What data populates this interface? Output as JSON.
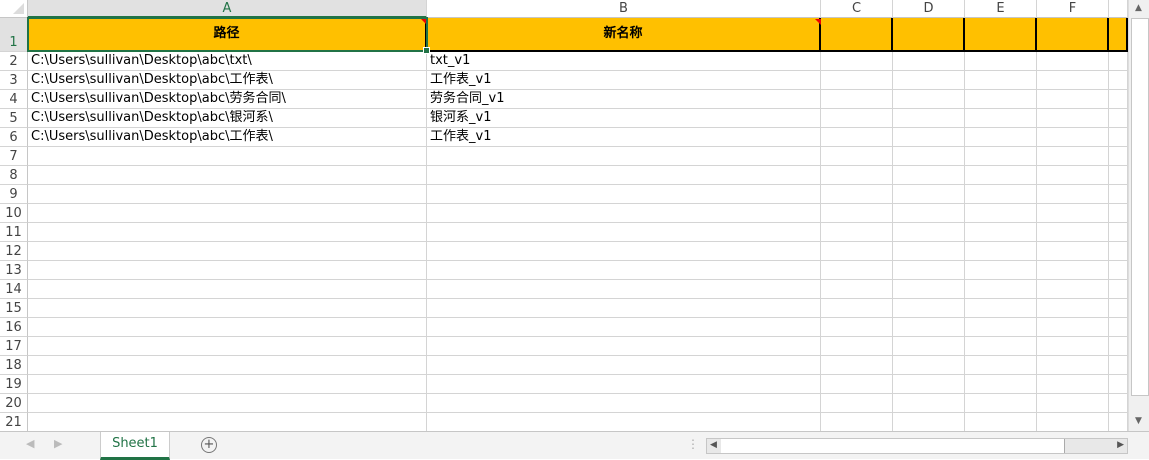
{
  "columns": [
    "A",
    "B",
    "C",
    "D",
    "E",
    "F",
    ""
  ],
  "selected_column": "A",
  "selected_row": 1,
  "header_row": {
    "A": "路径",
    "B": "新名称"
  },
  "rows": [
    {
      "row": 2,
      "A": "C:\\Users\\sullivan\\Desktop\\abc\\txt\\",
      "B": "txt_v1"
    },
    {
      "row": 3,
      "A": "C:\\Users\\sullivan\\Desktop\\abc\\工作表\\",
      "B": "工作表_v1"
    },
    {
      "row": 4,
      "A": "C:\\Users\\sullivan\\Desktop\\abc\\劳务合同\\",
      "B": "劳务合同_v1"
    },
    {
      "row": 5,
      "A": "C:\\Users\\sullivan\\Desktop\\abc\\银河系\\",
      "B": "银河系_v1"
    },
    {
      "row": 6,
      "A": "C:\\Users\\sullivan\\Desktop\\abc\\工作表\\",
      "B": "工作表_v1"
    }
  ],
  "row_numbers": [
    "1",
    "2",
    "3",
    "4",
    "5",
    "6",
    "7",
    "8",
    "9",
    "10",
    "11",
    "12",
    "13",
    "14",
    "15",
    "16",
    "17",
    "18",
    "19",
    "20",
    "21"
  ],
  "sheet_tabs": [
    "Sheet1"
  ],
  "colors": {
    "header_fill": "#FFC000",
    "accent": "#217346"
  }
}
